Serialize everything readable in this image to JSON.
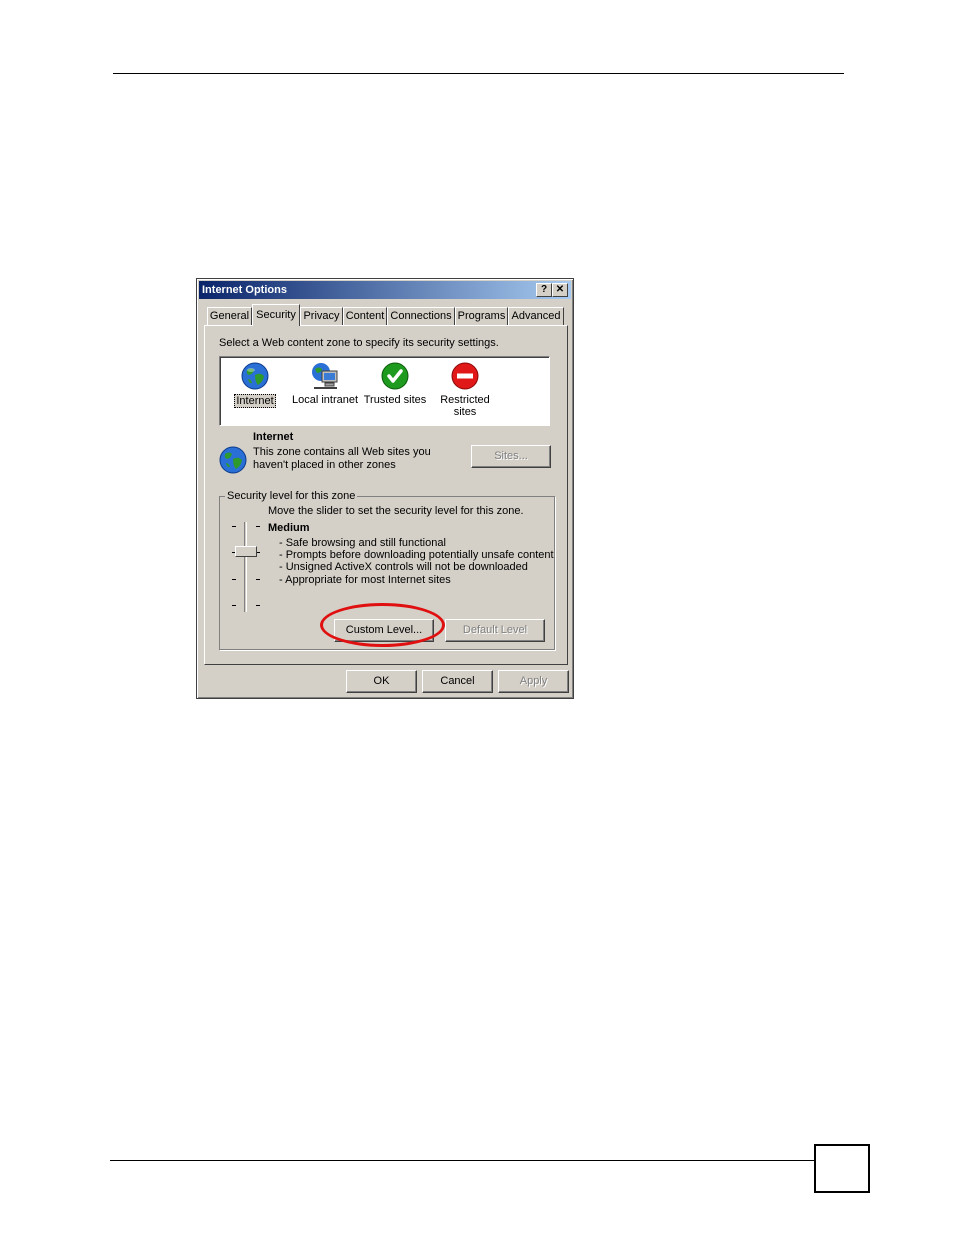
{
  "dialog": {
    "title": "Internet Options",
    "help_glyph": "?",
    "close_glyph": "✕",
    "tabs": [
      {
        "label": "General"
      },
      {
        "label": "Security"
      },
      {
        "label": "Privacy"
      },
      {
        "label": "Content"
      },
      {
        "label": "Connections"
      },
      {
        "label": "Programs"
      },
      {
        "label": "Advanced"
      }
    ],
    "active_tab": "Security",
    "instruction": "Select a Web content zone to specify its security settings.",
    "zones": [
      {
        "label": "Internet",
        "icon": "globe-icon"
      },
      {
        "label": "Local intranet",
        "icon": "network-computer-icon"
      },
      {
        "label": "Trusted sites",
        "icon": "green-check-icon"
      },
      {
        "label_line1": "Restricted",
        "label_line2": "sites",
        "icon": "red-no-entry-icon"
      }
    ],
    "selected_zone": {
      "name": "Internet",
      "desc_line1": "This zone contains all Web sites you",
      "desc_line2": "haven't placed in other zones",
      "icon": "globe-icon"
    },
    "sites_button": "Sites...",
    "security_level": {
      "group_label": "Security level for this zone",
      "slider_hint": "Move the slider to set the security level for this zone.",
      "level_name": "Medium",
      "bullets": [
        "- Safe browsing and still functional",
        "- Prompts before downloading potentially unsafe content",
        "- Unsigned ActiveX controls will not be downloaded",
        "- Appropriate for most Internet sites"
      ],
      "custom_level_button": "Custom Level...",
      "default_level_button": "Default Level"
    },
    "footer": {
      "ok": "OK",
      "cancel": "Cancel",
      "apply": "Apply"
    }
  },
  "colors": {
    "titlebar_start": "#0a246a",
    "titlebar_end": "#a6caf0",
    "dialog_face": "#d4d0c8",
    "highlight_ellipse": "#e01010"
  }
}
